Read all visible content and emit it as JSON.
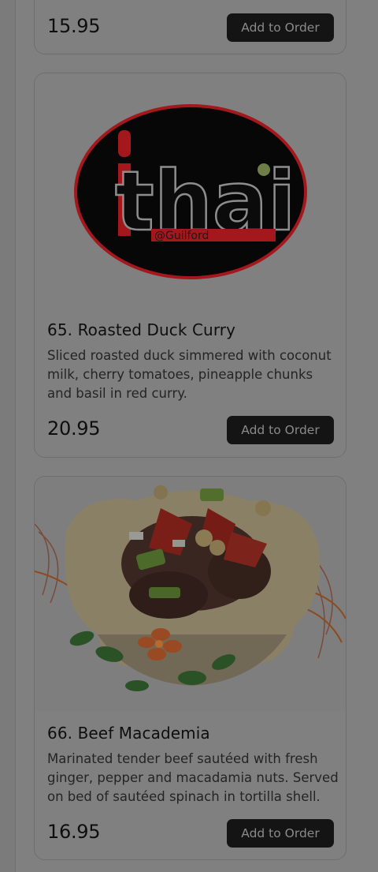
{
  "menu": {
    "items": [
      {
        "price": "15.95",
        "button_label": "Add to Order"
      },
      {
        "name": "65. Roasted Duck Curry",
        "description": "Sliced roasted duck simmered with coconut milk, cherry tomatoes, pineapple chunks and basil in red curry.",
        "price": "20.95",
        "button_label": "Add to Order",
        "image": {
          "kind": "logo",
          "text": "thai",
          "subtext": "@Guilford"
        }
      },
      {
        "name": "66. Beef Macademia",
        "description": "Marinated tender beef sautéed with fresh ginger, pepper and macadamia nuts. Served on bed of sautéed spinach in tortilla shell.",
        "price": "16.95",
        "button_label": "Add to Order",
        "image": {
          "kind": "photo"
        }
      }
    ]
  },
  "colors": {
    "overlay_background": "#808080",
    "button": "#141414",
    "logo_red": "#a3181c"
  }
}
